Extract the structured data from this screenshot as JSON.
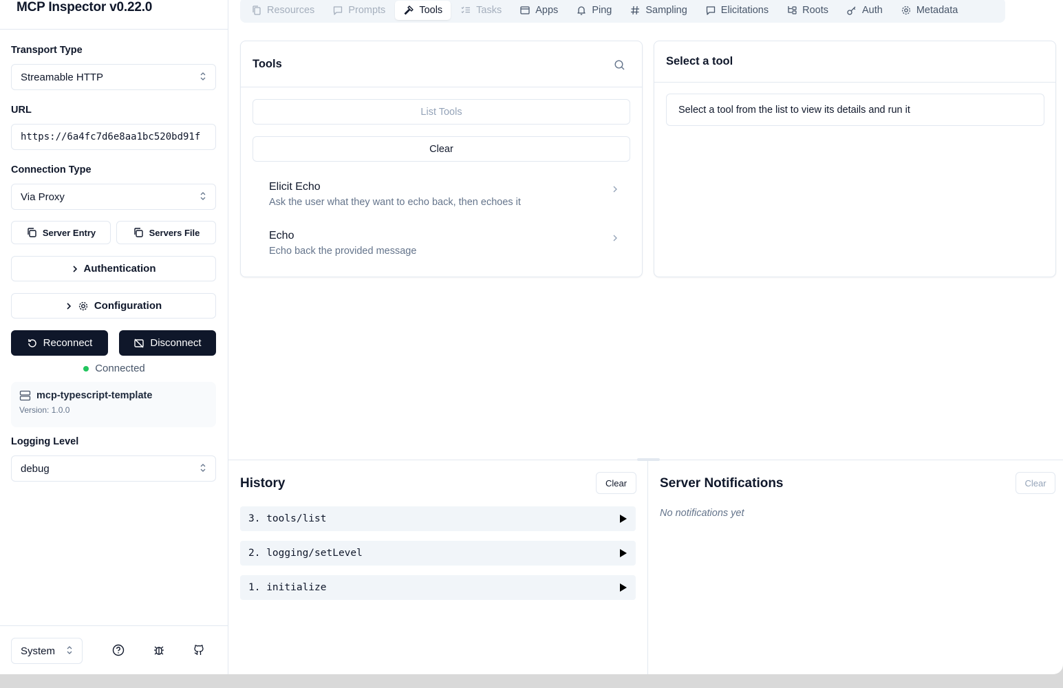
{
  "app": {
    "title": "MCP Inspector v0.22.0"
  },
  "sidebar": {
    "transport_label": "Transport Type",
    "transport_value": "Streamable HTTP",
    "url_label": "URL",
    "url_value": "https://6a4fc7d6e8aa1bc520bd91f",
    "connection_label": "Connection Type",
    "connection_value": "Via Proxy",
    "server_entry": "Server Entry",
    "servers_file": "Servers File",
    "authentication": "Authentication",
    "configuration": "Configuration",
    "reconnect": "Reconnect",
    "disconnect": "Disconnect",
    "status": "Connected",
    "server_name": "mcp-typescript-template",
    "server_version": "Version: 1.0.0",
    "logging_label": "Logging Level",
    "logging_value": "debug",
    "theme_value": "System"
  },
  "tabs": [
    {
      "label": "Resources",
      "icon": "files-icon",
      "state": "disabled"
    },
    {
      "label": "Prompts",
      "icon": "message-icon",
      "state": "disabled"
    },
    {
      "label": "Tools",
      "icon": "hammer-icon",
      "state": "active"
    },
    {
      "label": "Tasks",
      "icon": "list-checks-icon",
      "state": "disabled"
    },
    {
      "label": "Apps",
      "icon": "app-window-icon",
      "state": "normal"
    },
    {
      "label": "Ping",
      "icon": "bell-icon",
      "state": "normal"
    },
    {
      "label": "Sampling",
      "icon": "hash-icon",
      "state": "normal"
    },
    {
      "label": "Elicitations",
      "icon": "message-icon",
      "state": "normal"
    },
    {
      "label": "Roots",
      "icon": "folder-tree-icon",
      "state": "normal"
    },
    {
      "label": "Auth",
      "icon": "key-icon",
      "state": "normal"
    },
    {
      "label": "Metadata",
      "icon": "gear-icon",
      "state": "normal"
    }
  ],
  "tools_panel": {
    "title": "Tools",
    "list_button": "List Tools",
    "clear_button": "Clear",
    "items": [
      {
        "name": "Elicit Echo",
        "description": "Ask the user what they want to echo back, then echoes it"
      },
      {
        "name": "Echo",
        "description": "Echo back the provided message"
      }
    ]
  },
  "detail_panel": {
    "title": "Select a tool",
    "message": "Select a tool from the list to view its details and run it"
  },
  "history": {
    "title": "History",
    "clear": "Clear",
    "items": [
      "3. tools/list",
      "2. logging/setLevel",
      "1. initialize"
    ]
  },
  "notifications": {
    "title": "Server Notifications",
    "clear": "Clear",
    "empty": "No notifications yet"
  },
  "colors": {
    "primary": "#0f172a",
    "connected": "#22c55e",
    "muted": "#f1f5f9"
  }
}
